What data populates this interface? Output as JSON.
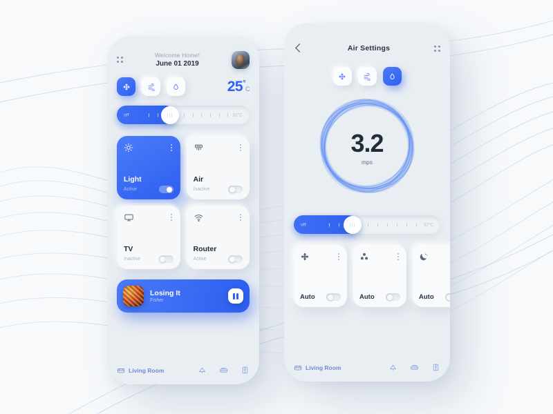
{
  "accent": "#2f60f0",
  "background": "#f7f9fb",
  "phone_left": {
    "menu_icon": "grid-dots-icon",
    "header": {
      "greeting": "Welcome Home!",
      "date": "June 01 2019",
      "avatar": "user-avatar"
    },
    "modes": [
      {
        "icon": "move-cross-icon",
        "active": true
      },
      {
        "icon": "wind-icon",
        "active": false
      },
      {
        "icon": "droplet-icon",
        "active": false
      }
    ],
    "temperature": {
      "value": "25",
      "degree": "°",
      "unit": "C"
    },
    "slider": {
      "off_label": "off",
      "max_label": "32°C",
      "fill_percent": 44,
      "thumb_percent": 40
    },
    "devices": [
      {
        "icon": "sun-icon",
        "name": "Light",
        "status": "Active",
        "on": true,
        "highlight": true
      },
      {
        "icon": "ac-icon",
        "name": "Air",
        "status": "Inactive",
        "on": false,
        "highlight": false
      },
      {
        "icon": "tv-icon",
        "name": "TV",
        "status": "Inactive",
        "on": false,
        "highlight": false
      },
      {
        "icon": "wifi-icon",
        "name": "Router",
        "status": "Active",
        "on": false,
        "highlight": false
      }
    ],
    "player": {
      "title": "Losing It",
      "artist": "Fisher",
      "control": "pause-icon"
    },
    "nav": {
      "room": "Living Room",
      "room_icon": "sofa-icon",
      "icons": [
        "lamp-icon",
        "bed-icon",
        "wardrobe-icon"
      ]
    }
  },
  "phone_right": {
    "header": {
      "back": "back-chevron-icon",
      "title": "Air Settings",
      "menu_icon": "grid-dots-icon"
    },
    "modes": [
      {
        "icon": "move-cross-icon",
        "active": false
      },
      {
        "icon": "wind-icon",
        "active": false
      },
      {
        "icon": "droplet-icon",
        "active": true
      }
    ],
    "gauge": {
      "value": "3.2",
      "unit": "mps"
    },
    "slider": {
      "off_label": "off",
      "max_label": "32°C",
      "fill_percent": 44,
      "thumb_percent": 40
    },
    "auto_cards": [
      {
        "icon": "fan-icon",
        "label": "Auto",
        "on": false
      },
      {
        "icon": "recycle-icon",
        "label": "Auto",
        "on": false
      },
      {
        "icon": "moon-icon",
        "label": "Auto",
        "on": false
      }
    ],
    "nav": {
      "room": "Living Room",
      "room_icon": "sofa-icon",
      "icons": [
        "lamp-icon",
        "bed-icon",
        "wardrobe-icon"
      ]
    }
  }
}
